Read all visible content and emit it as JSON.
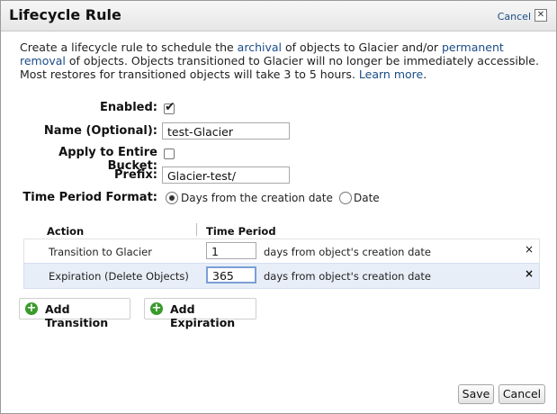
{
  "dialog": {
    "title": "Lifecycle Rule",
    "cancel_link": "Cancel",
    "close_glyph": "✕"
  },
  "intro": {
    "part1": "Create a lifecycle rule to schedule the ",
    "link1": "archival",
    "part2": " of objects to Glacier and/or ",
    "link2": "permanent removal",
    "part3": " of objects. Objects transitioned to Glacier will no longer be immediately accessible. Most restores for transitioned objects will take 3 to 5 hours. ",
    "link3": "Learn more",
    "part4": "."
  },
  "form": {
    "enabled_label": "Enabled:",
    "enabled_checked": true,
    "name_label": "Name (Optional):",
    "name_value": "test-Glacier",
    "bucket_label": "Apply to Entire Bucket:",
    "bucket_checked": false,
    "prefix_label": "Prefix:",
    "prefix_value": "Glacier-test/",
    "time_format_label": "Time Period Format:",
    "option_days": "Days from the creation date",
    "option_date": "Date",
    "selected_option": "days"
  },
  "table": {
    "headers": [
      "Action",
      "Time Period"
    ],
    "rows": [
      {
        "action": "Transition to Glacier",
        "value": "1",
        "suffix": "days from object's creation date"
      },
      {
        "action": "Expiration (Delete Objects)",
        "value": "365",
        "suffix": "days from object's creation date"
      }
    ],
    "remove_glyph": "×"
  },
  "buttons": {
    "add_transition": "Add Transition",
    "add_expiration": "Add Expiration",
    "save": "Save",
    "cancel": "Cancel"
  },
  "colors": {
    "link": "#1a4c86",
    "add_icon": "#3a9a2c"
  }
}
